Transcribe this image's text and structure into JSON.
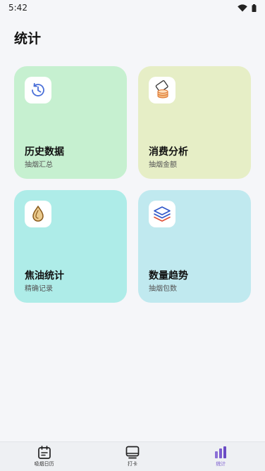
{
  "status_bar": {
    "time": "5:42"
  },
  "page": {
    "title": "统计"
  },
  "colors": {
    "card_history": "#c6f0d0",
    "card_consumption": "#e6eec6",
    "card_tar": "#aeece8",
    "card_trend": "#c0e9ef",
    "nav_active": "#7b5ccf"
  },
  "cards": [
    {
      "title": "历史数据",
      "subtitle": "抽烟汇总",
      "icon": "history-clock-icon"
    },
    {
      "title": "消费分析",
      "subtitle": "抽烟金额",
      "icon": "coins-card-icon"
    },
    {
      "title": "焦油统计",
      "subtitle": "精确记录",
      "icon": "oil-drop-icon"
    },
    {
      "title": "数量趋势",
      "subtitle": "抽烟包数",
      "icon": "layers-icon"
    }
  ],
  "bottom_nav": [
    {
      "label": "吸烟日历",
      "icon": "calendar-icon",
      "active": false
    },
    {
      "label": "打卡",
      "icon": "monitor-icon",
      "active": false
    },
    {
      "label": "统计",
      "icon": "bar-chart-icon",
      "active": true
    }
  ]
}
